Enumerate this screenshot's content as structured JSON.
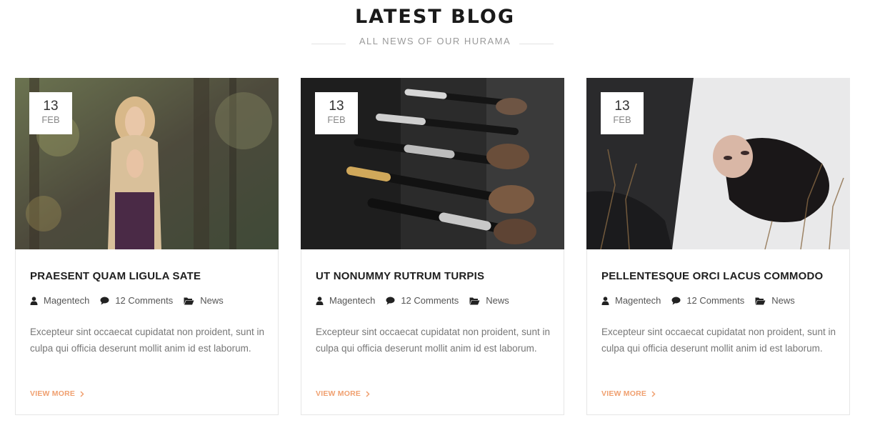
{
  "section": {
    "title": "LATEST BLOG",
    "subtitle": "ALL NEWS OF OUR HURAMA"
  },
  "posts": [
    {
      "day": "13",
      "month": "FEB",
      "title": "PRAESENT QUAM LIGULA SATE",
      "author": "Magentech",
      "comments": "12 Comments",
      "category": "News",
      "excerpt": "Excepteur sint occaecat cupidatat non proident, sunt in culpa qui officia deserunt mollit anim id est laborum.",
      "read_more": "VIEW MORE",
      "image_icon": "photo-forest-woman"
    },
    {
      "day": "13",
      "month": "FEB",
      "title": "UT NONUMMY RUTRUM TURPIS",
      "author": "Magentech",
      "comments": "12 Comments",
      "category": "News",
      "excerpt": "Excepteur sint occaecat cupidatat non proident, sunt in culpa qui officia deserunt mollit anim id est laborum.",
      "read_more": "VIEW MORE",
      "image_icon": "photo-makeup-brushes"
    },
    {
      "day": "13",
      "month": "FEB",
      "title": "PELLENTESQUE ORCI LACUS COMMODO",
      "author": "Magentech",
      "comments": "12 Comments",
      "category": "News",
      "excerpt": "Excepteur sint occaecat cupidatat non proident, sunt in culpa qui officia deserunt mollit anim id est laborum.",
      "read_more": "VIEW MORE",
      "image_icon": "photo-woman-in-snow"
    }
  ],
  "colors": {
    "accent": "#f0a070",
    "title": "#1a1a1a",
    "muted": "#9a9a9a",
    "border": "#e6e6e6"
  }
}
